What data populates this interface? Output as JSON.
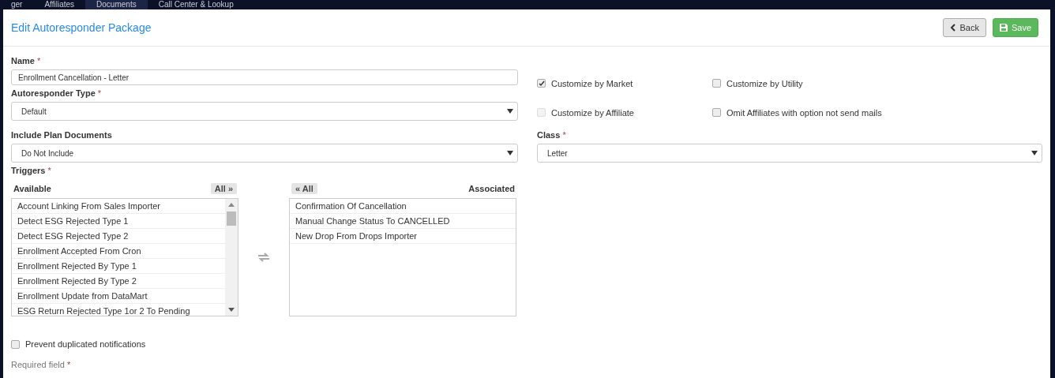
{
  "top_nav": [
    {
      "label": "ger",
      "selected": false
    },
    {
      "label": "Affiliates",
      "selected": false
    },
    {
      "label": "Documents",
      "selected": true
    },
    {
      "label": "Call Center & Lookup",
      "selected": false
    }
  ],
  "dialog": {
    "title": "Edit Autoresponder Package",
    "buttons": [
      {
        "kind": "back",
        "label": "Back"
      },
      {
        "kind": "save",
        "label": "Save"
      }
    ]
  },
  "name_field": {
    "label": "Name",
    "required_mark": "*",
    "value": "Enrollment Cancellation - Letter"
  },
  "autoresponder_type": {
    "label": "Autoresponder Type",
    "required_mark": "*",
    "value": "Default"
  },
  "options": [
    {
      "label": "Customize by Market",
      "checked": true,
      "disabled": false
    },
    {
      "label": "Customize by Utility",
      "checked": false,
      "disabled": false
    },
    {
      "label": "Customize by Affiliate",
      "checked": false,
      "disabled": true
    },
    {
      "label": "Omit Affiliates with option not send mails",
      "checked": false,
      "disabled": false
    }
  ],
  "include_plan_documents": {
    "label": "Include Plan Documents",
    "value": "Do Not Include"
  },
  "class": {
    "label": "Class",
    "required_mark": "*",
    "value": "Letter"
  },
  "triggers": {
    "label": "Triggers",
    "required_mark": "*",
    "available": {
      "title": "Available",
      "move_all": "All »",
      "items": [
        "Account Linking From Sales Importer",
        "Detect ESG Rejected Type 1",
        "Detect ESG Rejected Type 2",
        "Enrollment Accepted From Cron",
        "Enrollment Rejected By Type 1",
        "Enrollment Rejected By Type 2",
        "Enrollment Update from DataMart",
        "ESG Return Rejected Type 1or 2 To Pending"
      ]
    },
    "associated": {
      "title": "Associated",
      "move_all": "« All",
      "items": [
        "Confirmation Of Cancellation",
        "Manual Change Status To CANCELLED",
        "New Drop From Drops Importer"
      ]
    }
  },
  "prevent_duplicates": {
    "label": "Prevent duplicated notifications",
    "checked": false
  },
  "footer_note": {
    "label": "Required field",
    "required_mark": "*"
  }
}
